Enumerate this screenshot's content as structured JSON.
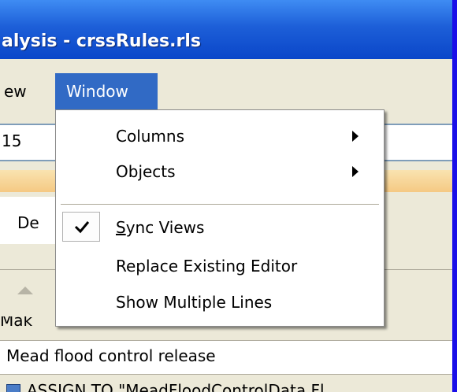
{
  "window": {
    "title": "alysis - crssRules.rls"
  },
  "menubar": {
    "view_label": "ew",
    "window_label": "Window"
  },
  "toolbar": {
    "combo_value": "15"
  },
  "panel": {
    "tab_label": "De",
    "cut_text": "Mak",
    "description": "Mead flood control release",
    "code_line": "ASSIGN TO \"MeadFloodControlData.Fl"
  },
  "window_menu": {
    "items": [
      {
        "label": "Columns",
        "submenu": true
      },
      {
        "label": "Objects",
        "submenu": true
      },
      {
        "label": "Sync Views",
        "checked": true,
        "mnemonic": "S"
      },
      {
        "label": "Replace Existing Editor"
      },
      {
        "label": "Show Multiple Lines"
      }
    ],
    "sync_mnemonic": "S",
    "sync_rest": "ync Views"
  },
  "colors": {
    "titlebar": "#1d5fd8",
    "menu_highlight": "#316ac5",
    "background": "#1a0fe8"
  },
  "icons": {
    "check": "check-icon",
    "submenu_arrow": "chevron-right-icon"
  }
}
